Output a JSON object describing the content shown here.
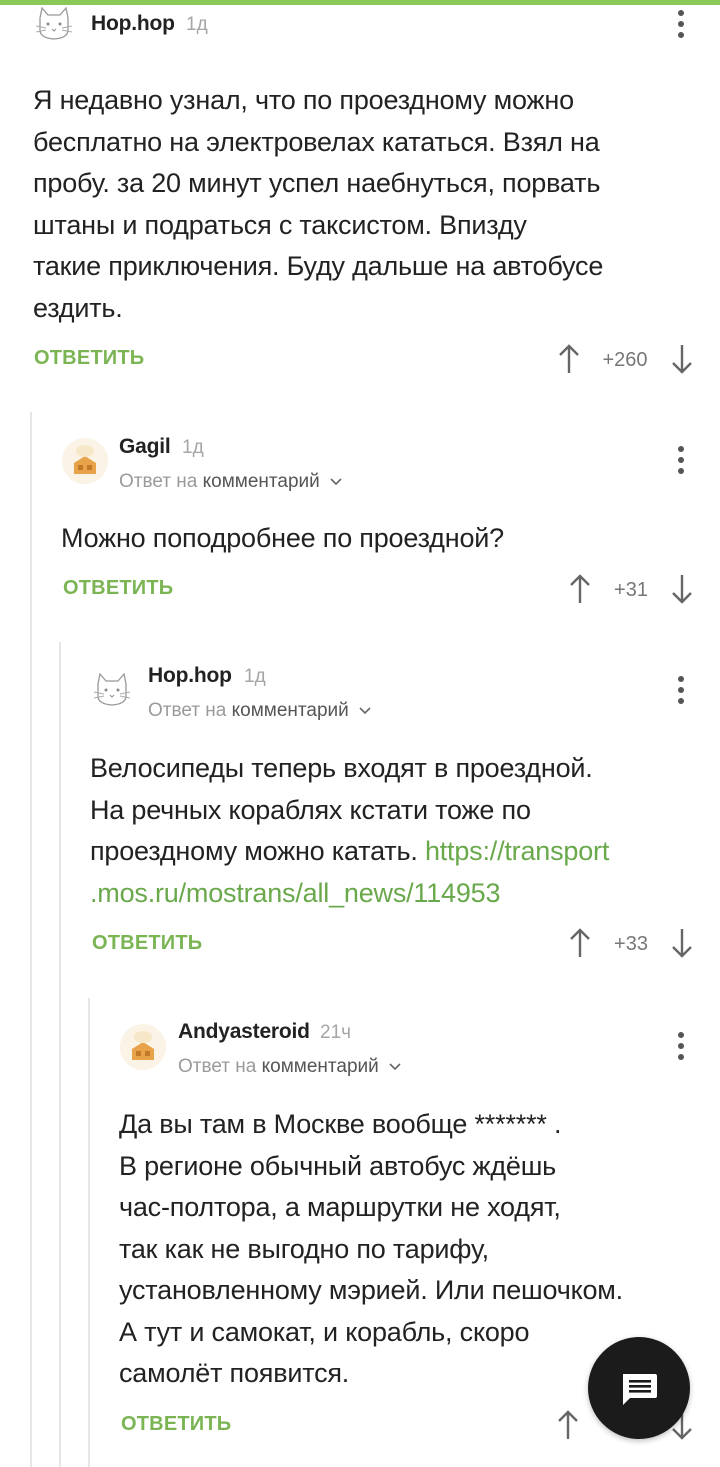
{
  "comments": [
    {
      "author": "Hop.hop",
      "time": "1д",
      "lines": [
        "Я недавно узнал, что по проездному можно",
        "бесплатно на электровелах кататься. Взял на",
        "пробу. за 20 минут успел наебнуться, порвать",
        "штаны и подраться с таксистом. Впизду",
        "такие приключения. Буду дальше на автобусе",
        "ездить."
      ],
      "reply_label": "ОТВЕТИТЬ",
      "rating": "+260",
      "avatar_icon": "cat-avatar-icon"
    },
    {
      "author": "Gagil",
      "time": "1д",
      "reply_prefix": "Ответ на",
      "reply_target": "комментарий",
      "lines": [
        "Можно поподробнее по проездной?"
      ],
      "reply_label": "ОТВЕТИТЬ",
      "rating": "+31",
      "avatar_icon": "default-avatar-icon"
    },
    {
      "author": "Hop.hop",
      "time": "1д",
      "reply_prefix": "Ответ на",
      "reply_target": "комментарий",
      "lines": [
        "Велосипеды теперь входят в проездной.",
        "На речных кораблях кстати тоже по",
        "проездному можно катать."
      ],
      "link_part1": "https://transport",
      "link_part2": ".mos.ru/mostrans/all_news/114953",
      "reply_label": "ОТВЕТИТЬ",
      "rating": "+33",
      "avatar_icon": "cat-avatar-icon"
    },
    {
      "author": "Andyasteroid",
      "time": "21ч",
      "reply_prefix": "Ответ на",
      "reply_target": "комментарий",
      "lines": [
        "Да вы там в Москве вообще ******* .",
        "В регионе обычный автобус ждёшь",
        "час-полтора, а маршрутки не ходят,",
        "так как не выгодно по тарифу,",
        "установленному мэрией. Или пешочком.",
        "А тут и самокат, и корабль, скоро",
        "самолёт появится."
      ],
      "reply_label": "ОТВЕТИТЬ",
      "avatar_icon": "default-avatar-icon"
    }
  ],
  "colors": {
    "accent": "#7bb553",
    "link": "#69a84b",
    "fab": "#1b1b1b"
  },
  "fab_icon": "comment-icon"
}
